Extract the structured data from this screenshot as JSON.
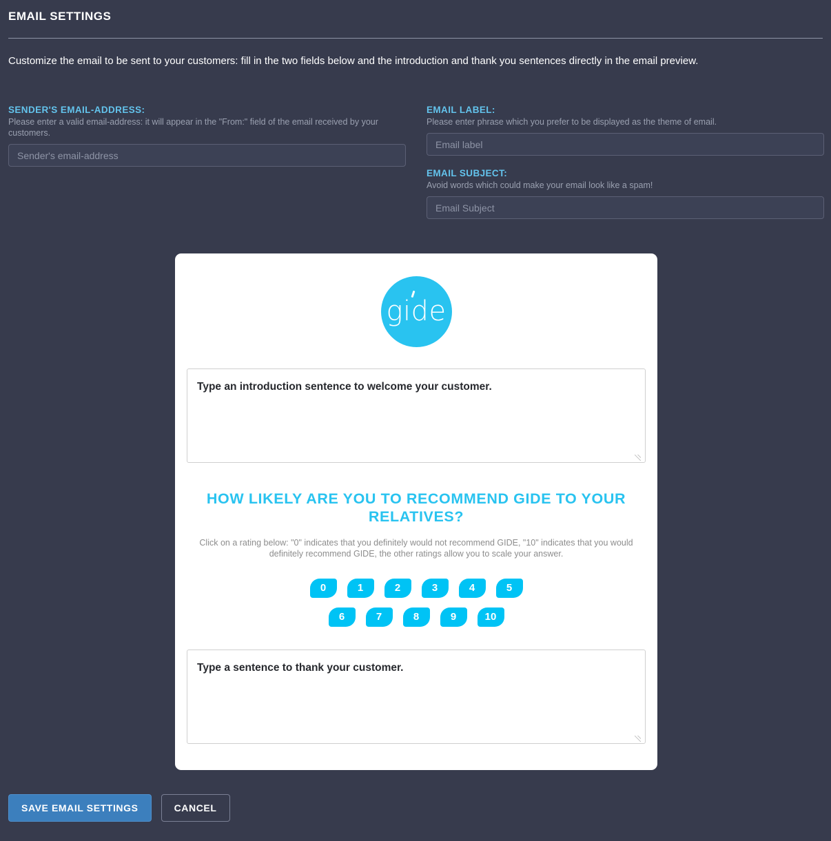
{
  "header": {
    "title": "Email settings",
    "intro": "Customize the email to be sent to your customers: fill in the two fields below and the introduction and thank you sentences directly in the email preview."
  },
  "form": {
    "sender": {
      "label": "Sender's email-address:",
      "help": "Please enter a valid email-address: it will appear in the \"From:\" field of the email received by your customers.",
      "placeholder": "Sender's email-address",
      "value": ""
    },
    "email_label": {
      "label": "Email label:",
      "help": "Please enter phrase which you prefer to be displayed as the theme of email.",
      "placeholder": "Email label",
      "value": ""
    },
    "email_subject": {
      "label": "Email subject:",
      "help": "Avoid words which could make your email look like a spam!",
      "placeholder": "Email Subject",
      "value": ""
    }
  },
  "preview": {
    "logo_text": "gide",
    "intro_note": "Type an introduction sentence to welcome your customer.",
    "question_title": "How likely are you to recommend GIDE to your relatives?",
    "question_help": "Click on a rating below: \"0\" indicates that you definitely would not recommend GIDE, \"10\" indicates that you would definitely recommend GIDE, the other ratings allow you to scale your answer.",
    "ratings_row1": [
      "0",
      "1",
      "2",
      "3",
      "4",
      "5"
    ],
    "ratings_row2": [
      "6",
      "7",
      "8",
      "9",
      "10"
    ],
    "thanks_note": "Type a sentence to thank your customer."
  },
  "footer": {
    "save_label": "Save email settings",
    "cancel_label": "Cancel"
  },
  "colors": {
    "page_background": "#373b4d",
    "accent_label": "#63c3ec",
    "brand_cyan": "#29c3f0",
    "rating_cyan": "#00c3f5",
    "primary_button": "#3c7fbd",
    "card_background": "#ffffff"
  }
}
